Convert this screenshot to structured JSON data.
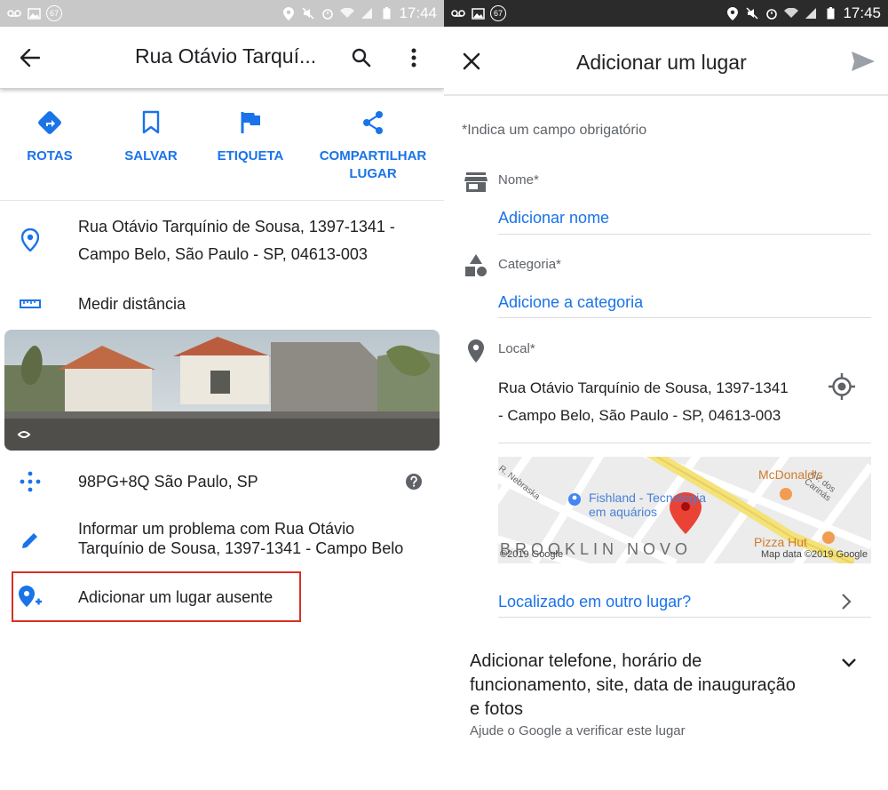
{
  "left": {
    "status": {
      "time": "17:44",
      "badge": "67"
    },
    "appbar": {
      "title": "Rua Otávio Tarquí..."
    },
    "actions": [
      {
        "label": "ROTAS"
      },
      {
        "label": "SALVAR"
      },
      {
        "label": "ETIQUETA"
      },
      {
        "label": "COMPARTILHAR",
        "label2": "LUGAR"
      }
    ],
    "address": {
      "line1": "Rua Otávio Tarquínio de Sousa, 1397-1341 -",
      "line2": "Campo Belo, São Paulo - SP, 04613-003"
    },
    "measure": "Medir distância",
    "pluscode": "98PG+8Q São Paulo, SP",
    "report": {
      "line1": "Informar um problema com Rua Otávio",
      "line2": "Tarquínio de Sousa, 1397-1341 - Campo Belo"
    },
    "add_missing": "Adicionar um lugar ausente"
  },
  "right": {
    "status": {
      "time": "17:45",
      "badge": "67"
    },
    "appbar": {
      "title": "Adicionar um lugar"
    },
    "hint": "*Indica um campo obrigatório",
    "name": {
      "label": "Nome*",
      "placeholder": "Adicionar nome"
    },
    "category": {
      "label": "Categoria*",
      "placeholder": "Adicione a categoria"
    },
    "location": {
      "label": "Local*",
      "line1": "Rua Otávio Tarquínio de Sousa, 1397-1341",
      "line2": "- Campo Belo, São Paulo - SP, 04613-003"
    },
    "map": {
      "street1": "R. Nebraska",
      "street2": "Av. dos Carinás",
      "poi1": "Fishland - Tecnologia",
      "poi1b": "em aquários",
      "poi2": "McDonald's",
      "poi3": "Pizza Hut",
      "district": "BROOKLIN NOVO",
      "copyright": "©2019 Google",
      "mapdata": "Map data ©2019 Google"
    },
    "elsewhere": "Localizado em outro lugar?",
    "extra": {
      "line1": "Adicionar telefone, horário de",
      "line2": "funcionamento, site, data de inauguração",
      "line3": "e fotos",
      "sub": "Ajude o Google a verificar este lugar"
    }
  },
  "colors": {
    "accent": "#1a73e8",
    "highlight": "#d93025",
    "pin": "#ea4335"
  }
}
